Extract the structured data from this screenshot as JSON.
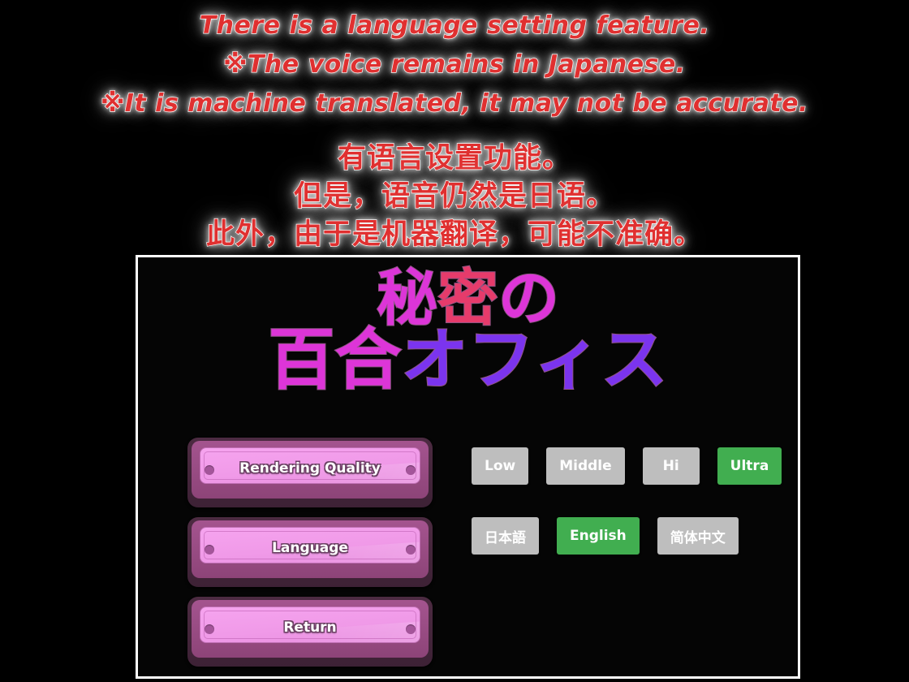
{
  "notice": {
    "english": [
      "There is a language setting feature.",
      "※The voice remains in Japanese.",
      "※It is machine translated, it may not be accurate."
    ],
    "chinese": [
      "有语言设置功能。",
      "但是，语音仍然是日语。",
      "此外，由于是机器翻译，可能不准确。"
    ],
    "text_color": "#e03030",
    "glow_color": "#ffffff"
  },
  "game": {
    "title": {
      "line1": [
        {
          "char": "秘",
          "color": "#dd35d8"
        },
        {
          "char": "密",
          "color": "#e63b6b"
        },
        {
          "char": "の",
          "color": "#dd35d8"
        }
      ],
      "line2": [
        {
          "char": "百",
          "color": "#dd35d8"
        },
        {
          "char": "合",
          "color": "#dd35d8"
        },
        {
          "char": "オ",
          "color": "#7b34ee"
        },
        {
          "char": "フ",
          "color": "#7b34ee"
        },
        {
          "char": "ィ",
          "color": "#7b34ee"
        },
        {
          "char": "ス",
          "color": "#7b34ee"
        }
      ],
      "line1_text": "秘密の",
      "line2_text": "百合オフィス"
    },
    "menu": [
      {
        "label": "Rendering Quality"
      },
      {
        "label": "Language"
      },
      {
        "label": "Return"
      }
    ],
    "quality_options": [
      {
        "label": "Low",
        "selected": false
      },
      {
        "label": "Middle",
        "selected": false
      },
      {
        "label": "Hi",
        "selected": false
      },
      {
        "label": "Ultra",
        "selected": true
      }
    ],
    "language_options": [
      {
        "label": "日本語",
        "selected": false
      },
      {
        "label": "English",
        "selected": true
      },
      {
        "label": "简体中文",
        "selected": false
      }
    ],
    "colors": {
      "option_default": "#bebebe",
      "option_selected": "#41ae50",
      "plate_face": "#f0a0e8",
      "plate_frame": "#8d4478",
      "plate_outer": "#4d2b42",
      "window_border": "#ffffff",
      "background": "#000000"
    }
  }
}
